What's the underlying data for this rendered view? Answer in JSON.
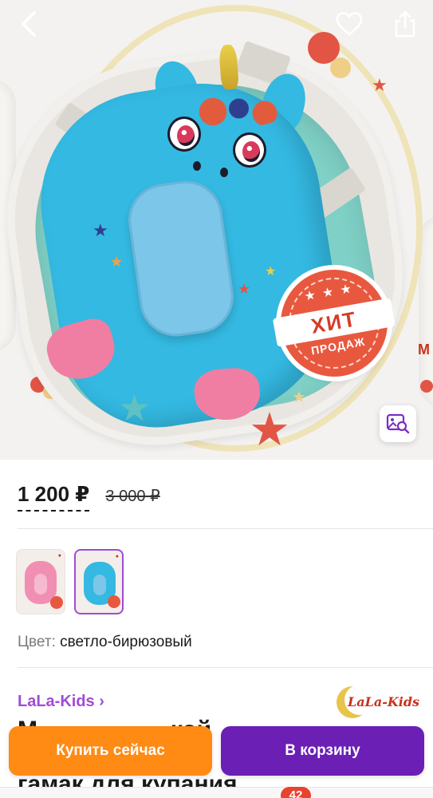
{
  "colors": {
    "accent_purple": "#a04bd6",
    "cart_button": "#6b1fb4",
    "buy_button": "#ff8a14",
    "badge_red": "#e8432f"
  },
  "header": {
    "back_icon": "chevron-left-icon",
    "favorite_icon": "heart-icon",
    "share_icon": "share-icon"
  },
  "gallery": {
    "badge_line1": "ХИТ",
    "badge_line2": "ПРОДАЖ",
    "zoom_icon": "image-search-icon",
    "next_peek_text": "M"
  },
  "price": {
    "current": "1 200 ₽",
    "old": "3 000 ₽"
  },
  "variants": {
    "items": [
      {
        "color": "pink",
        "selected": false
      },
      {
        "color": "turquoise",
        "selected": true
      }
    ]
  },
  "color_option": {
    "label": "Цвет:",
    "value": "светло-бирюзовый"
  },
  "brand": {
    "name": "LaLa-Kids ›",
    "logo_text": "LaLa-Kids"
  },
  "product": {
    "title_partial": "М                    кой\n                          о\nгамак для купания"
  },
  "actions": {
    "buy_now": "Купить сейчас",
    "add_to_cart": "В корзину"
  },
  "tabbar": {
    "cart_count": "42"
  }
}
